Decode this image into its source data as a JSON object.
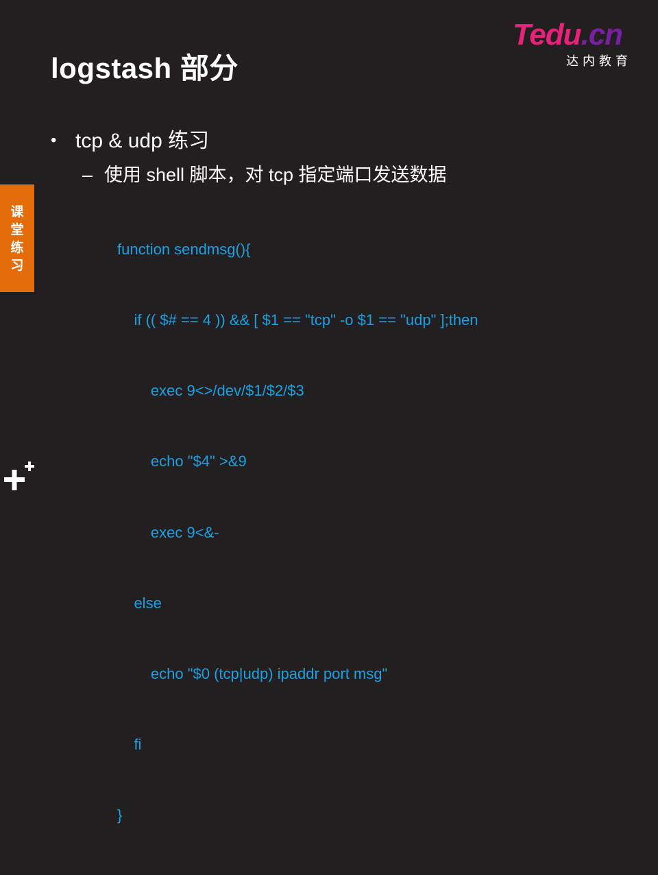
{
  "slide": {
    "title": "logstash 部分",
    "logo": {
      "main_prefix": "Te",
      "main_mid": "du",
      "main_suffix": ".cn",
      "subtitle": "达内教育"
    },
    "side_tab": {
      "chars": [
        "课",
        "堂",
        "练",
        "习"
      ]
    },
    "bullet_1": "tcp & udp 练习",
    "bullet_2": "使用 shell 脚本，对 tcp 指定端口发送数据",
    "code_lines": [
      "function sendmsg(){",
      "    if (( $# == 4 )) && [ $1 == \"tcp\" -o $1 == \"udp\" ];then",
      "        exec 9<>/dev/$1/$2/$3",
      "        echo \"$4\" >&9",
      "        exec 9<&-",
      "    else",
      "        echo \"$0 (tcp|udp) ipaddr port msg\"",
      "    fi",
      "}"
    ],
    "colors": {
      "background": "#231f20",
      "code": "#1ba1e2",
      "tab": "#e46c0a",
      "logo_pink": "#e8217a"
    },
    "icons": {
      "corner": "plus-icon"
    }
  }
}
